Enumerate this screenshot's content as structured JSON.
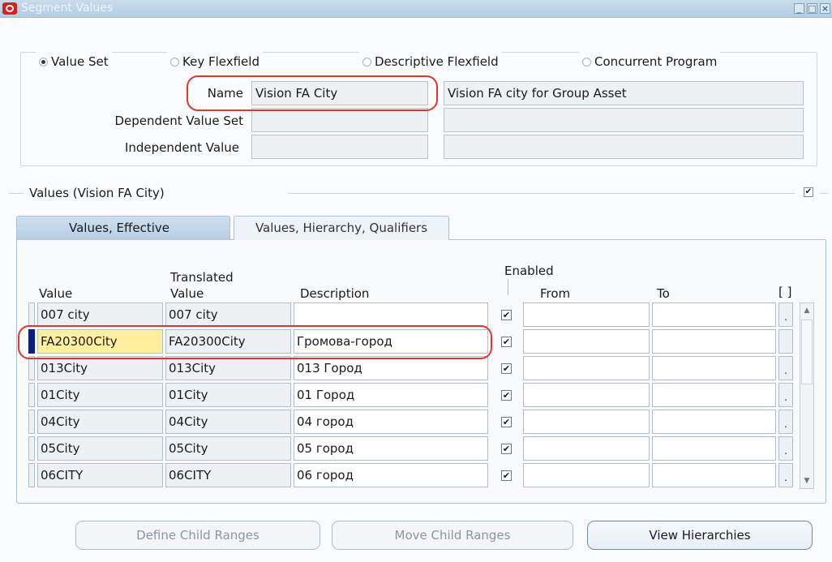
{
  "window": {
    "title": "Segment Values",
    "controls": [
      "minimize",
      "maximize",
      "close"
    ]
  },
  "source_options": [
    {
      "label": "Value Set",
      "selected": true
    },
    {
      "label": "Key Flexfield",
      "selected": false
    },
    {
      "label": "Descriptive Flexfield",
      "selected": false
    },
    {
      "label": "Concurrent Program",
      "selected": false
    }
  ],
  "header_fields": {
    "name_label": "Name",
    "name_value": "Vision FA City",
    "name_description": "Vision FA city for Group Asset",
    "dependent_label": "Dependent Value Set",
    "dependent_value": "",
    "dependent_description": "",
    "independent_label": "Independent Value",
    "independent_value": "",
    "independent_description": ""
  },
  "values_section": {
    "title": "Values (Vision FA City)",
    "checked": true
  },
  "tabs": [
    {
      "label": "Values, Effective",
      "active": true
    },
    {
      "label": "Values, Hierarchy, Qualifiers",
      "active": false
    }
  ],
  "table": {
    "headers": {
      "value": "Value",
      "translated_top": "Translated",
      "translated_bottom": "Value",
      "description": "Description",
      "enabled": "Enabled",
      "from": "From",
      "to": "To",
      "more": "[ ]"
    },
    "rows": [
      {
        "value": "007 city",
        "translated": "007 city",
        "description": "",
        "enabled": true,
        "from": "",
        "to": "",
        "current": false
      },
      {
        "value": "FA20300City",
        "translated": "FA20300City",
        "description": "Громова-город",
        "enabled": true,
        "from": "",
        "to": "",
        "current": true
      },
      {
        "value": "013City",
        "translated": "013City",
        "description": "013 Город",
        "enabled": true,
        "from": "",
        "to": "",
        "current": false
      },
      {
        "value": "01City",
        "translated": "01City",
        "description": "01 Город",
        "enabled": true,
        "from": "",
        "to": "",
        "current": false
      },
      {
        "value": "04City",
        "translated": "04City",
        "description": "04 город",
        "enabled": true,
        "from": "",
        "to": "",
        "current": false
      },
      {
        "value": "05City",
        "translated": "05City",
        "description": "05 город",
        "enabled": true,
        "from": "",
        "to": "",
        "current": false
      },
      {
        "value": "06CITY",
        "translated": "06CITY",
        "description": "06 город",
        "enabled": true,
        "from": "",
        "to": "",
        "current": false
      }
    ]
  },
  "buttons": {
    "define_child_ranges": "Define Child Ranges",
    "move_child_ranges": "Move Child Ranges",
    "view_hierarchies": "View Hierarchies"
  },
  "colors": {
    "highlight_ring": "#e0362f",
    "current_record": "#0b1d8a",
    "current_field": "#ffef9e",
    "tab_active": "#b6cee4"
  }
}
